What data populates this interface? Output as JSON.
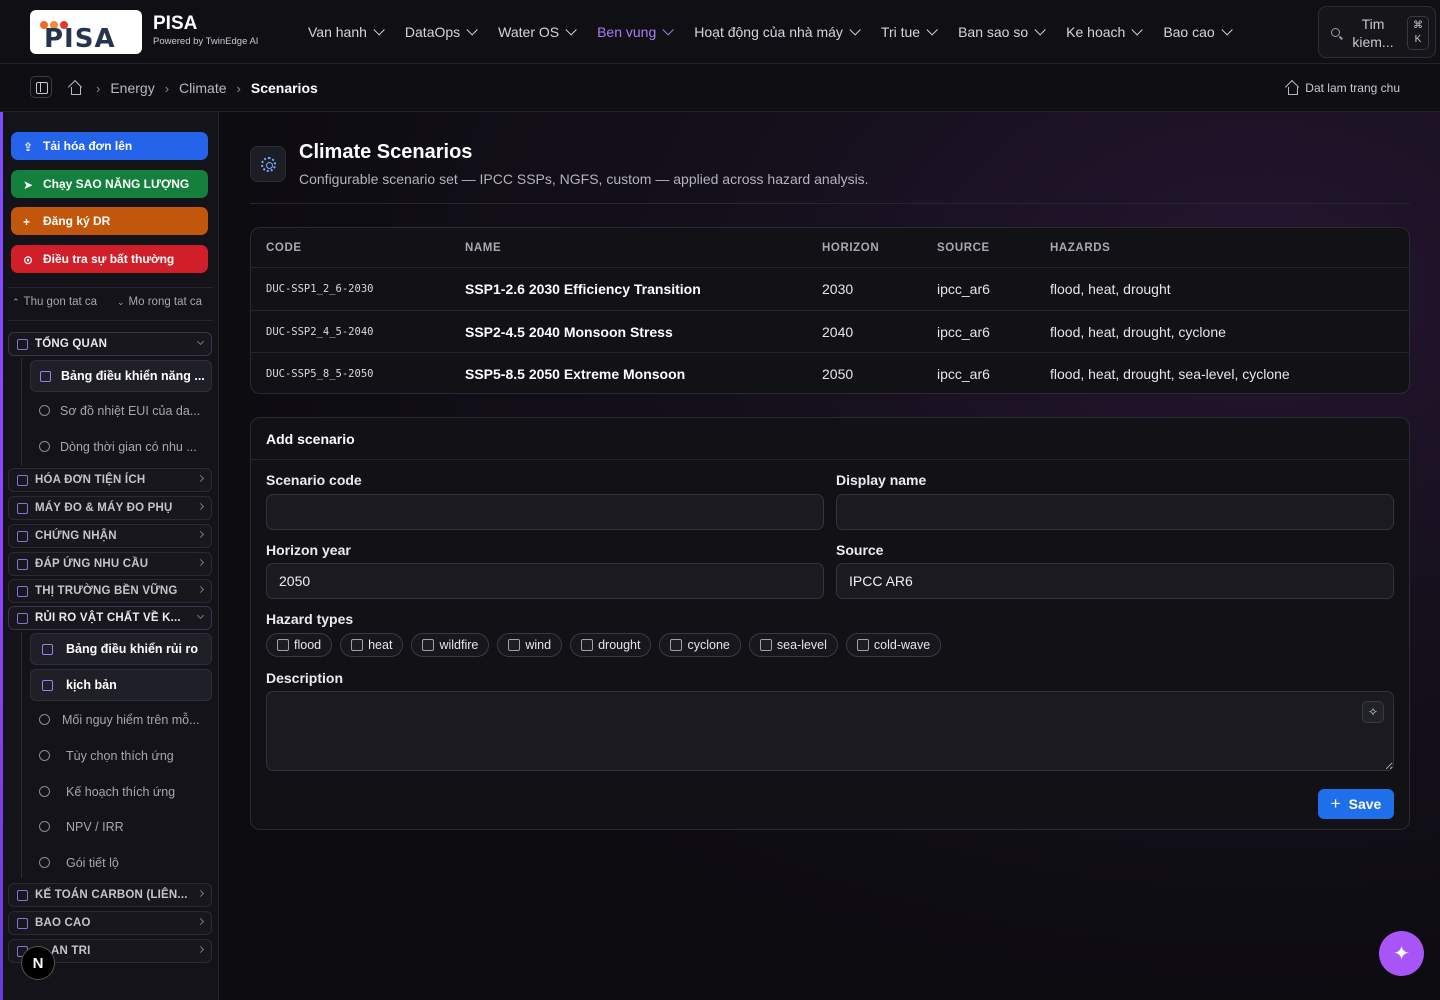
{
  "brand": {
    "logo_text": "PISA",
    "title": "PISA",
    "subtitle": "Powered by TwinEdge AI"
  },
  "nav": [
    {
      "label": "Van hanh",
      "active": false
    },
    {
      "label": "DataOps",
      "active": false
    },
    {
      "label": "Water OS",
      "active": false
    },
    {
      "label": "Ben vung",
      "active": true
    },
    {
      "label": "Hoạt động của nhà máy",
      "active": false
    },
    {
      "label": "Tri tue",
      "active": false
    },
    {
      "label": "Ban sao so",
      "active": false
    },
    {
      "label": "Ke hoach",
      "active": false
    },
    {
      "label": "Bao cao",
      "active": false
    }
  ],
  "search": {
    "label_line1": "Tim",
    "label_line2": "kiem...",
    "kbd_line1": "⌘",
    "kbd_line2": "K"
  },
  "breadcrumb": {
    "items": [
      "Energy",
      "Climate"
    ],
    "current": "Scenarios",
    "set_home": "Dat lam trang chu"
  },
  "sidebar": {
    "actions": [
      {
        "label": "Tải hóa đơn lên",
        "icon": "upload-icon",
        "color": "#2563eb"
      },
      {
        "label": "Chạy SAO NĂNG LƯỢNG",
        "icon": "send-icon",
        "color": "#15803d"
      },
      {
        "label": "Đăng ký DR",
        "icon": "plus-icon",
        "color": "#c2560c"
      },
      {
        "label": "Điều tra sự bất thường",
        "icon": "alert-circle-icon",
        "color": "#d11f2a"
      }
    ],
    "collapse_all": "Thu gon tat ca",
    "expand_all": "Mo rong tat ca",
    "sections": {
      "overview": {
        "label": "TỔNG QUAN",
        "items": [
          "Bảng điều khiển năng ...",
          "Sơ đồ nhiệt EUI của da...",
          "Dòng thời gian có nhu ..."
        ]
      },
      "utility_bills": "HÓA ĐƠN TIỆN ÍCH",
      "meters": "MÁY ĐO & MÁY ĐO PHỤ",
      "certification": "CHỨNG NHẬN",
      "demand_response": "ĐÁP ỨNG NHU CẦU",
      "sustainability_market": "THỊ TRƯỜNG BỀN VỮNG",
      "physical_risk": {
        "label": "RỦI RO VẬT CHẤT VỀ K...",
        "items": [
          "Bảng điều khiển rủi ro",
          "kịch bản",
          "Mối nguy hiểm trên mỗ...",
          "Tùy chọn thích ứng",
          "Kế hoạch thích ứng",
          "NPV / IRR",
          "Gói tiết lộ"
        ]
      },
      "carbon_accounting": "KẾ TOÁN CARBON (LIÊN...",
      "reports": "BAO CAO",
      "admin": "AN TRI"
    },
    "badge": "N"
  },
  "page": {
    "title": "Climate Scenarios",
    "subtitle": "Configurable scenario set — IPCC SSPs, NGFS, custom — applied across hazard analysis."
  },
  "table": {
    "headers": {
      "code": "CODE",
      "name": "NAME",
      "horizon": "HORIZON",
      "source": "SOURCE",
      "hazards": "HAZARDS"
    },
    "rows": [
      {
        "code": "DUC-SSP1_2_6-2030",
        "name": "SSP1-2.6 2030 Efficiency Transition",
        "horizon": "2030",
        "source": "ipcc_ar6",
        "hazards": "flood, heat, drought"
      },
      {
        "code": "DUC-SSP2_4_5-2040",
        "name": "SSP2-4.5 2040 Monsoon Stress",
        "horizon": "2040",
        "source": "ipcc_ar6",
        "hazards": "flood, heat, drought, cyclone"
      },
      {
        "code": "DUC-SSP5_8_5-2050",
        "name": "SSP5-8.5 2050 Extreme Monsoon",
        "horizon": "2050",
        "source": "ipcc_ar6",
        "hazards": "flood, heat, drought, sea-level, cyclone"
      }
    ]
  },
  "form": {
    "title": "Add scenario",
    "scenario_code_label": "Scenario code",
    "scenario_code_value": "",
    "display_name_label": "Display name",
    "display_name_value": "",
    "horizon_label": "Horizon year",
    "horizon_value": "2050",
    "source_label": "Source",
    "source_value": "IPCC AR6",
    "hazard_label": "Hazard types",
    "hazards": [
      {
        "label": "flood",
        "checked": false
      },
      {
        "label": "heat",
        "checked": false
      },
      {
        "label": "wildfire",
        "checked": false
      },
      {
        "label": "wind",
        "checked": false
      },
      {
        "label": "drought",
        "checked": false
      },
      {
        "label": "cyclone",
        "checked": false
      },
      {
        "label": "sea-level",
        "checked": false
      },
      {
        "label": "cold-wave",
        "checked": false
      }
    ],
    "description_label": "Description",
    "description_value": "",
    "save_label": "Save"
  },
  "colors": {
    "accent": "#a77cf5",
    "primary": "#1f6feb",
    "fab": "#a855f7"
  }
}
